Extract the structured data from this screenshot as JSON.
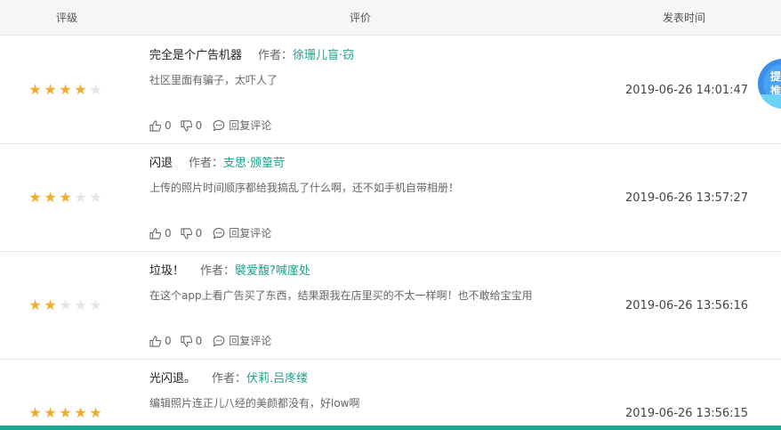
{
  "header": {
    "rating": "评级",
    "review": "评价",
    "time": "发表时间"
  },
  "reviews": [
    {
      "stars": 4,
      "title": "完全是个广告机器",
      "author_label": "作者：",
      "author": "徐珊儿盲·窃",
      "content": "社区里面有骗子，太吓人了",
      "likes": "0",
      "dislikes": "0",
      "reply": "回复评论",
      "time": "2019-06-26 14:01:47"
    },
    {
      "stars": 3,
      "title": "闪退",
      "author_label": "作者：",
      "author": "支思·颁篁苛",
      "content": "上传的照片时间顺序都给我搞乱了什么啊，还不如手机自带相册！",
      "likes": "0",
      "dislikes": "0",
      "reply": "回复评论",
      "time": "2019-06-26 13:57:27"
    },
    {
      "stars": 2,
      "title": "垃圾！",
      "author_label": "作者：",
      "author": "襞爱馥?喊廑处",
      "content": "在这个app上看广告买了东西，结果跟我在店里买的不太一样啊！也不敢给宝宝用",
      "likes": "0",
      "dislikes": "0",
      "reply": "回复评论",
      "time": "2019-06-26 13:56:16"
    },
    {
      "stars": 5,
      "title": "光闪退。",
      "author_label": "作者：",
      "author": "伏莉.吕庝缕",
      "content": "编辑照片连正儿八经的美颜都没有，好low啊",
      "likes": "",
      "dislikes": "",
      "reply": "",
      "time": "2019-06-26 13:56:15"
    }
  ],
  "badge": {
    "text": "提\n推"
  },
  "colors": {
    "star_on": "#f0ad2c",
    "star_off": "#e5e5e5",
    "author": "#1aa28a",
    "bottom_bar": "#19a993"
  }
}
